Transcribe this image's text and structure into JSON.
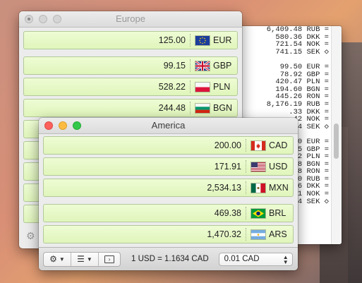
{
  "colors": {
    "row_bg": "#e5f7c3",
    "row_border": "#b2c99a"
  },
  "europe": {
    "title": "Europe",
    "rows": [
      {
        "amount": "125.00",
        "code": "EUR",
        "flag": "eu-flag-icon"
      },
      {
        "amount": "99.15",
        "code": "GBP",
        "flag": "uk-flag-icon"
      },
      {
        "amount": "528.22",
        "code": "PLN",
        "flag": "poland-flag-icon"
      },
      {
        "amount": "244.48",
        "code": "BGN",
        "flag": "bulgaria-flag-icon"
      }
    ]
  },
  "log": {
    "lines": [
      "6,409.48 RUB =",
      "580.36 DKK =",
      "721.54 NOK =",
      "741.15 SEK ◇",
      "",
      "99.50 EUR =",
      "78.92 GBP =",
      "420.47 PLN =",
      "194.60 BGN =",
      "445.26 RON =",
      "8,176.19 RUB =",
      ".33 DKK =",
      ".42 NOK =",
      ".44 SEK ◇",
      "",
      ".00 EUR =",
      ".15 GBP =",
      ".22 PLN =",
      ".48 BGN =",
      ".28 RON =",
      ".60 RUB =",
      ".06 DKK =",
      ".31 NOK =",
      ".74 SEK ◇"
    ]
  },
  "america": {
    "title": "America",
    "rows": [
      {
        "amount": "200.00",
        "code": "CAD",
        "flag": "canada-flag-icon"
      },
      {
        "amount": "171.91",
        "code": "USD",
        "flag": "usa-flag-icon"
      },
      {
        "amount": "2,534.13",
        "code": "MXN",
        "flag": "mexico-flag-icon"
      },
      {
        "amount": "469.38",
        "code": "BRL",
        "flag": "brazil-flag-icon"
      },
      {
        "amount": "1,470.32",
        "code": "ARS",
        "flag": "argentina-flag-icon"
      }
    ],
    "toolbar": {
      "settings_icon": "gear-icon",
      "list_icon": "list-icon",
      "console_icon": "console-icon",
      "rate_text": "1 USD = 1.1634 CAD",
      "precision_value": "0.01 CAD"
    }
  }
}
